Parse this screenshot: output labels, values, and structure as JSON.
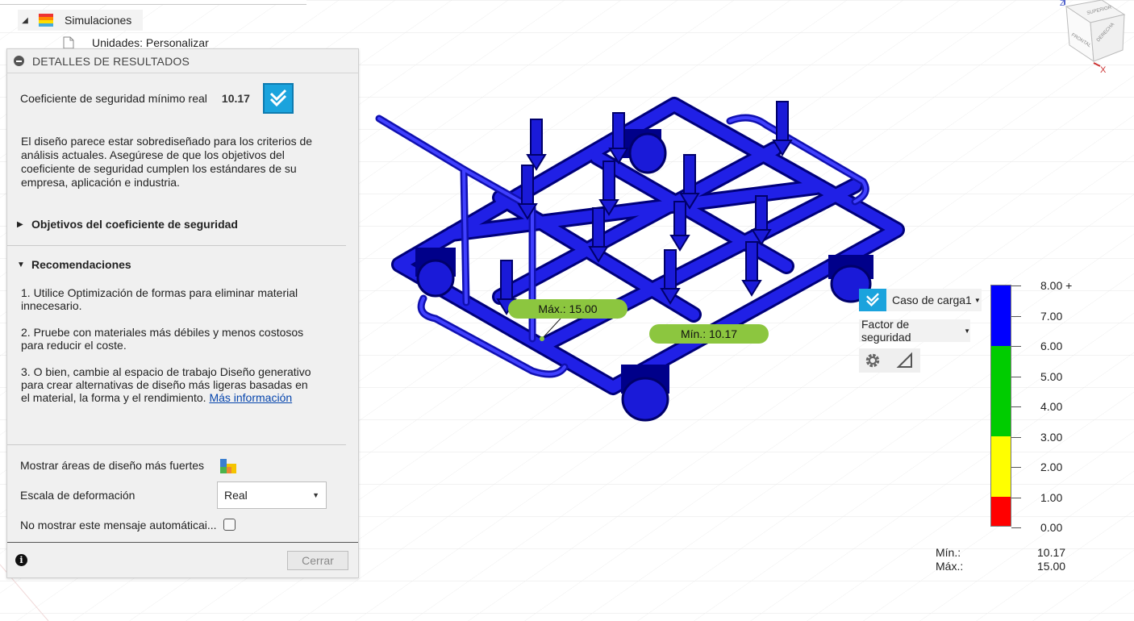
{
  "tree": {
    "simulations_label": "Simulaciones",
    "units_label": "Unidades: Personalizar"
  },
  "panel": {
    "title": "DETALLES DE RESULTADOS",
    "fos_label": "Coeficiente de seguridad mínimo real",
    "fos_value": "10.17",
    "description": "El diseño parece estar sobrediseñado para los criterios de análisis actuales. Asegúrese de que los objetivos del coeficiente de seguridad cumplen los estándares de su empresa, aplicación e industria.",
    "section_objectives": "Objetivos del coeficiente de seguridad",
    "section_recommendations": "Recomendaciones",
    "recommendations": [
      "1. Utilice Optimización de formas para eliminar material innecesario.",
      "2. Pruebe con materiales más débiles y menos costosos para reducir el coste.",
      "3. O bien, cambie al espacio de trabajo Diseño generativo para crear alternativas de diseño más ligeras basadas en el material, la forma y el rendimiento."
    ],
    "more_info_link": "Más información",
    "show_strong_areas_label": "Mostrar áreas de diseño más fuertes",
    "deformation_scale_label": "Escala de deformación",
    "deformation_scale_value": "Real",
    "dont_show_label": "No mostrar este mensaje automáticai...",
    "close_button": "Cerrar"
  },
  "result_toolbar": {
    "load_case": "Caso de carga1",
    "result_type": "Factor de seguridad"
  },
  "legend": {
    "labels": [
      "8.00 +",
      "7.00",
      "6.00",
      "5.00",
      "4.00",
      "3.00",
      "2.00",
      "1.00",
      "0.00"
    ],
    "colors": [
      "#0000ff",
      "#00cc00",
      "#ffff00",
      "#ff0000"
    ]
  },
  "summary": {
    "min_label": "Mín.:",
    "min_value": "10.17",
    "max_label": "Máx.:",
    "max_value": "15.00"
  },
  "model_tags": {
    "max": "Máx.: 15.00",
    "min": "Mín.: 10.17"
  },
  "viewcube": {
    "top": "SUPERIOR",
    "front": "FRONTAL",
    "right": "DERECHA",
    "axis_z": "Z",
    "axis_x": "X"
  }
}
